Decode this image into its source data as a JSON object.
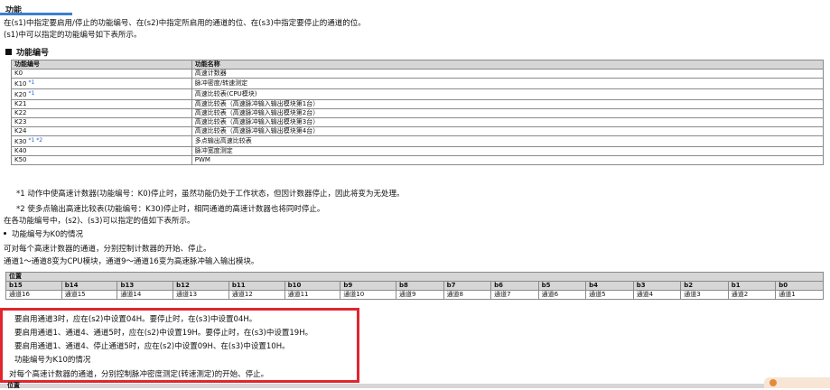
{
  "heading": "功能",
  "intro": {
    "line1": "在(s1)中指定要启用/停止的功能编号、在(s2)中指定所启用的通道的位、在(s3)中指定要停止的通道的位。",
    "line2": "(s1)中可以指定的功能编号如下表所示。"
  },
  "func_section_title": "功能编号",
  "func_table": {
    "headers": [
      "功能编号",
      "功能名称"
    ],
    "rows": [
      {
        "code": "K0",
        "sup": "",
        "name": "高速计数器"
      },
      {
        "code": "K10",
        "sup": "*1",
        "name": "脉冲密度/转速测定"
      },
      {
        "code": "K20",
        "sup": "*1",
        "name": "高速比较表(CPU模块)"
      },
      {
        "code": "K21",
        "sup": "",
        "name": "高速比较表（高速脉冲输入输出模块第1台）"
      },
      {
        "code": "K22",
        "sup": "",
        "name": "高速比较表（高速脉冲输入输出模块第2台）"
      },
      {
        "code": "K23",
        "sup": "",
        "name": "高速比较表（高速脉冲输入输出模块第3台）"
      },
      {
        "code": "K24",
        "sup": "",
        "name": "高速比较表（高速脉冲输入输出模块第4台）"
      },
      {
        "code": "K30",
        "sup": "*1 *2",
        "name": "多点输出高速比较表"
      },
      {
        "code": "K40",
        "sup": "",
        "name": "脉冲宽度测定"
      },
      {
        "code": "K50",
        "sup": "",
        "name": "PWM"
      }
    ]
  },
  "notes": {
    "n1": "*1  动作中使高速计数器(功能编号：K0)停止时，虽然功能仍处于工作状态，但因计数器停止，因此将变为无处理。",
    "n2": "*2  使多点输出高速比较表(功能编号：K30)停止时，相同通道的高速计数器也将同时停止。"
  },
  "spec_text": "在各功能编号中，(s2)、(s3)可以指定的值如下表所示。",
  "k0_case": {
    "title": "功能编号为K0的情况",
    "desc1": "可对每个高速计数器的通道，分别控制计数器的开始、停止。",
    "desc2": "通道1～通道8变为CPU模块，通道9～通道16变为高速脉冲输入输出模块。"
  },
  "bit_table": {
    "label": "位置",
    "bits": [
      "b15",
      "b14",
      "b13",
      "b12",
      "b11",
      "b10",
      "b9",
      "b8",
      "b7",
      "b6",
      "b5",
      "b4",
      "b3",
      "b2",
      "b1",
      "b0"
    ],
    "channels": [
      "通道16",
      "通道15",
      "通道14",
      "通道13",
      "通道12",
      "通道11",
      "通道10",
      "通道9",
      "通道8",
      "通道7",
      "通道6",
      "通道5",
      "通道4",
      "通道3",
      "通道2",
      "通道1"
    ]
  },
  "examples": [
    "要启用通道3时，应在(s2)中设置04H。要停止时，在(s3)中设置04H。",
    "要启用通道1、通道4、通道5时，应在(s2)中设置19H。要停止时，在(s3)中设置19H。",
    "要启用通道1、通道4、停止通道5时，应在(s2)中设置09H、在(s3)中设置10H。"
  ],
  "k10_case": {
    "title": "功能编号为K10的情况",
    "desc": "对每个高速计数器的通道，分别控制脉冲密度测定(转速测定)的开始、停止。"
  },
  "next_table_label": "位置",
  "highlight_color": "#e0262e"
}
